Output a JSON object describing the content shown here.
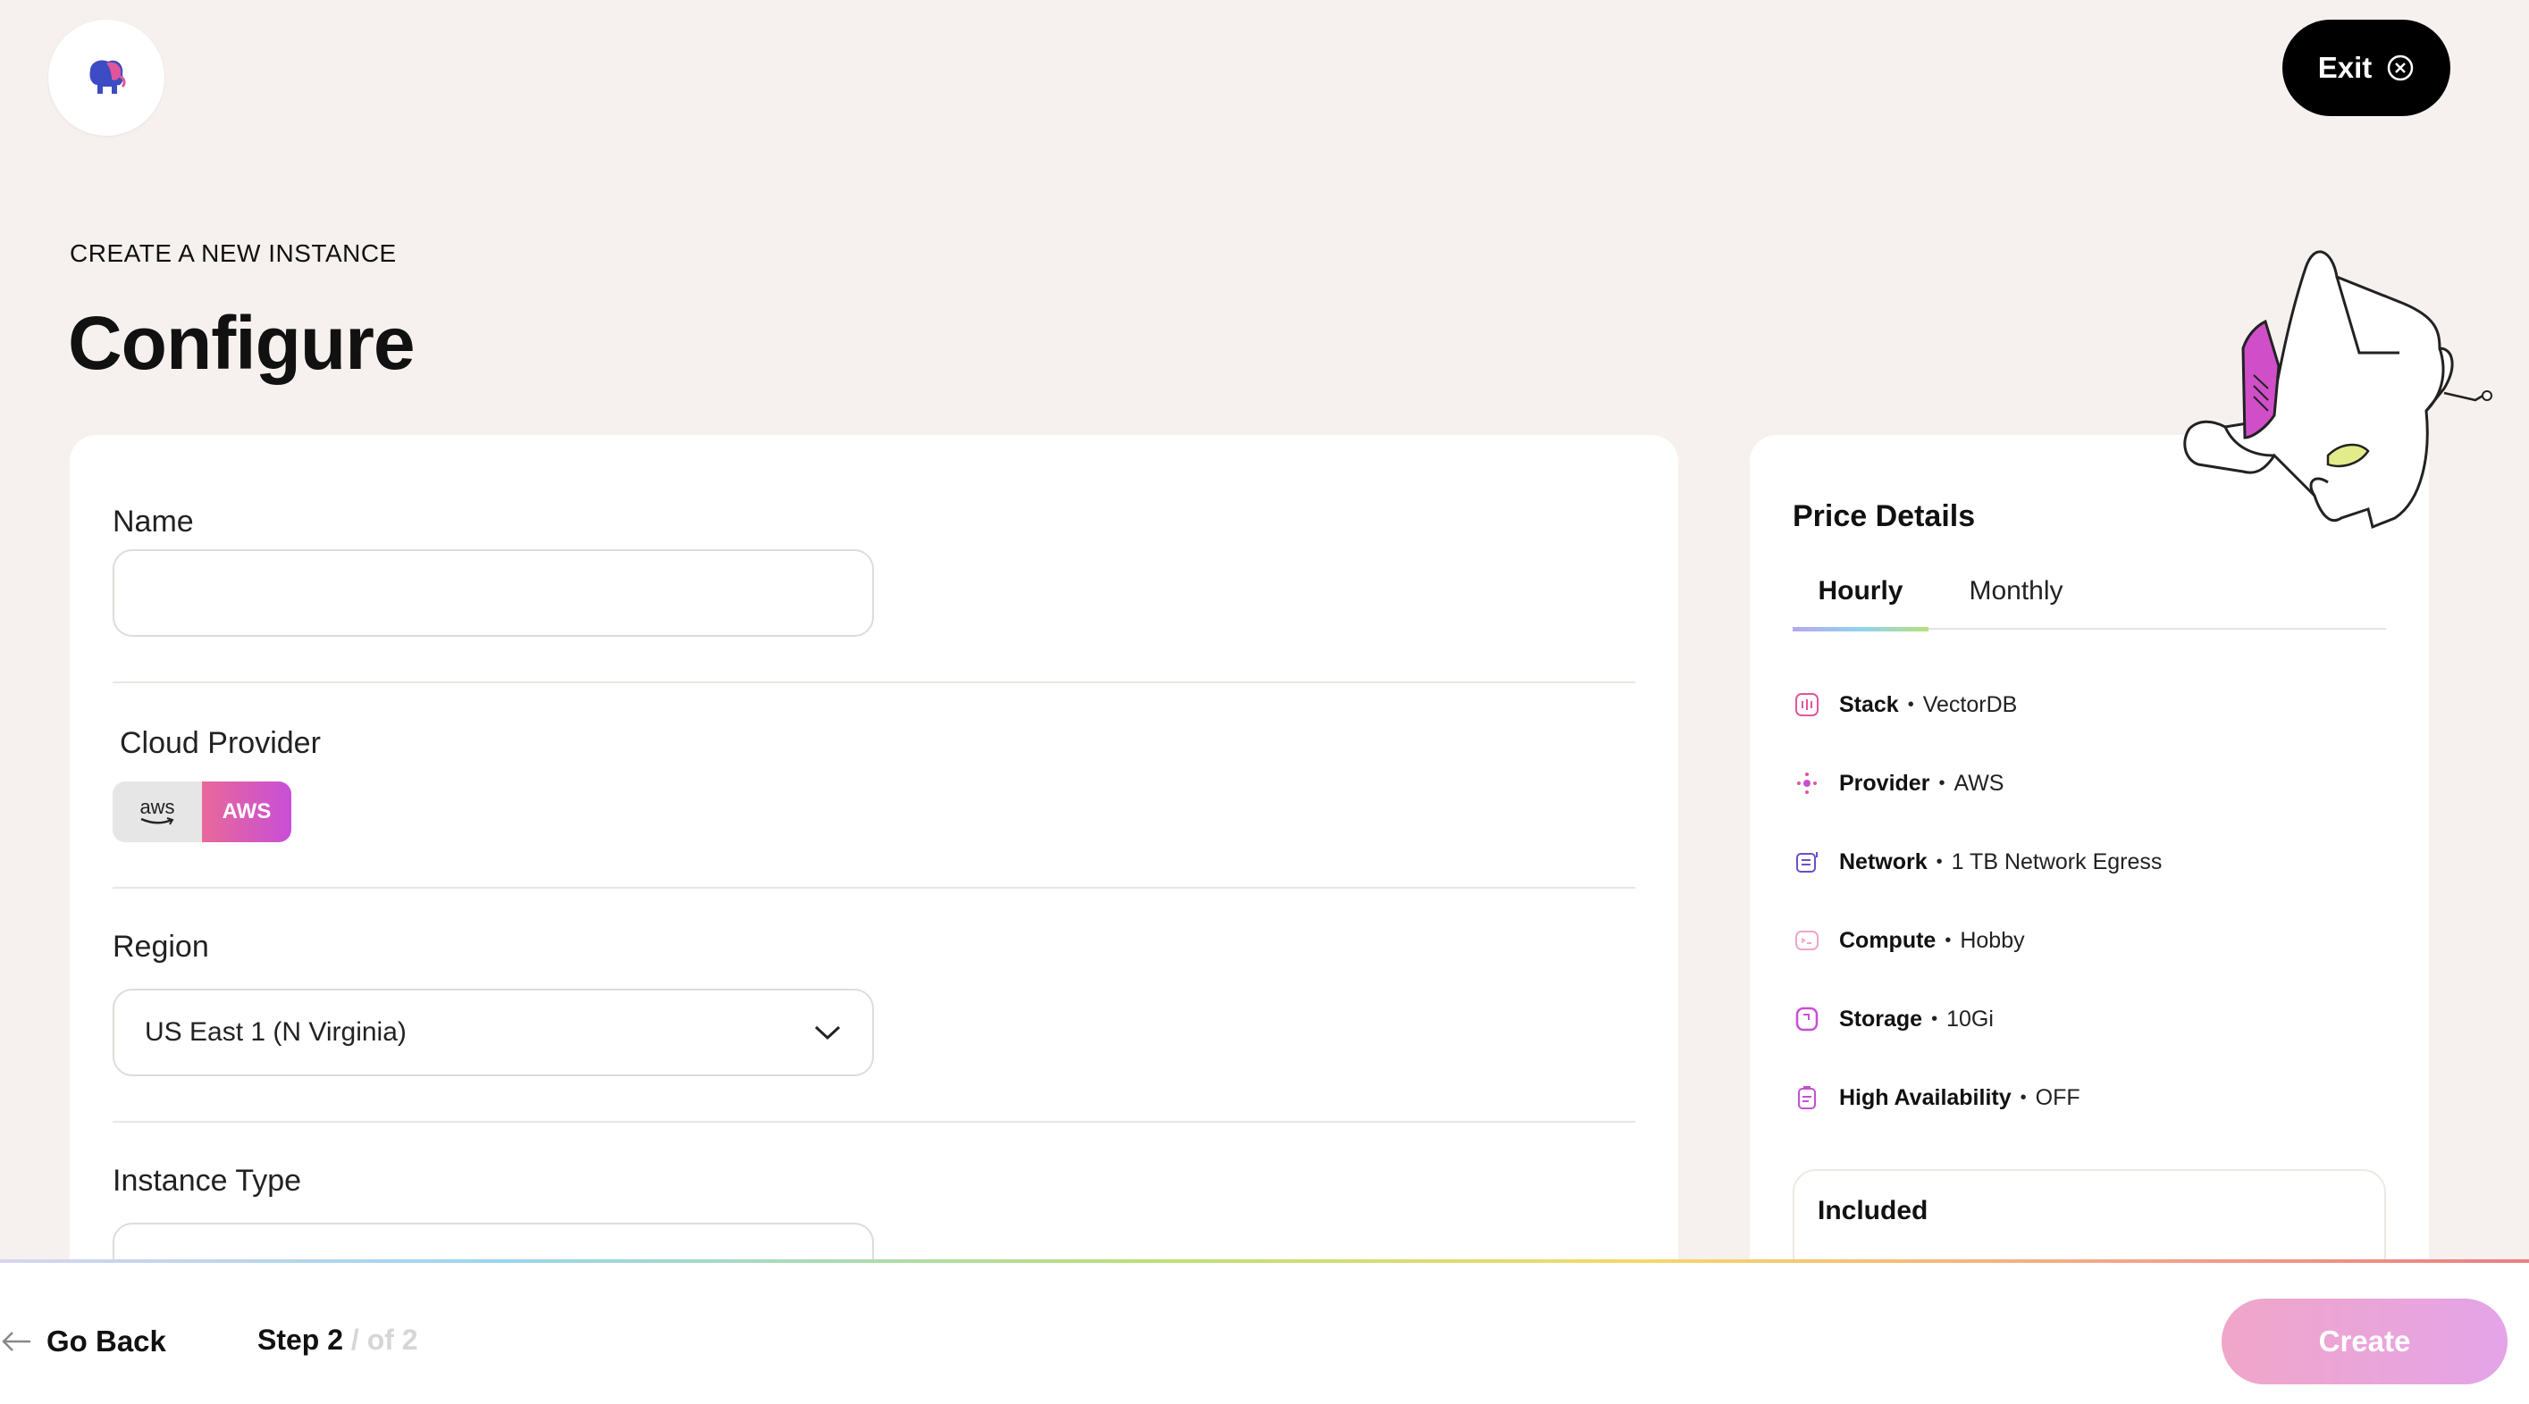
{
  "header": {
    "exit_label": "Exit"
  },
  "page": {
    "eyebrow": "CREATE A NEW INSTANCE",
    "title": "Configure"
  },
  "form": {
    "name_label": "Name",
    "name_value": "",
    "cloud_provider_label": "Cloud Provider",
    "provider_logo_text": "aws",
    "provider_selected": "AWS",
    "region_label": "Region",
    "region_value": "US East 1 (N Virginia)",
    "instance_type_label": "Instance Type"
  },
  "price_details": {
    "title": "Price Details",
    "tabs": [
      {
        "label": "Hourly",
        "active": true
      },
      {
        "label": "Monthly",
        "active": false
      }
    ],
    "items": [
      {
        "key": "Stack",
        "value": "VectorDB",
        "icon": "stack-icon"
      },
      {
        "key": "Provider",
        "value": "AWS",
        "icon": "provider-icon"
      },
      {
        "key": "Network",
        "value": "1 TB Network Egress",
        "icon": "network-icon"
      },
      {
        "key": "Compute",
        "value": "Hobby",
        "icon": "compute-icon"
      },
      {
        "key": "Storage",
        "value": "10Gi",
        "icon": "storage-icon"
      },
      {
        "key": "High Availability",
        "value": "OFF",
        "icon": "high-availability-icon"
      }
    ],
    "included_title": "Included"
  },
  "footer": {
    "go_back_label": "Go Back",
    "step_current": "Step 2",
    "step_total": "/ of 2",
    "create_label": "Create"
  },
  "colors": {
    "background": "#f6f1ee",
    "accent_pink": "#e9689a",
    "accent_purple": "#c74fd6",
    "create_button": "#f0a6c8"
  }
}
